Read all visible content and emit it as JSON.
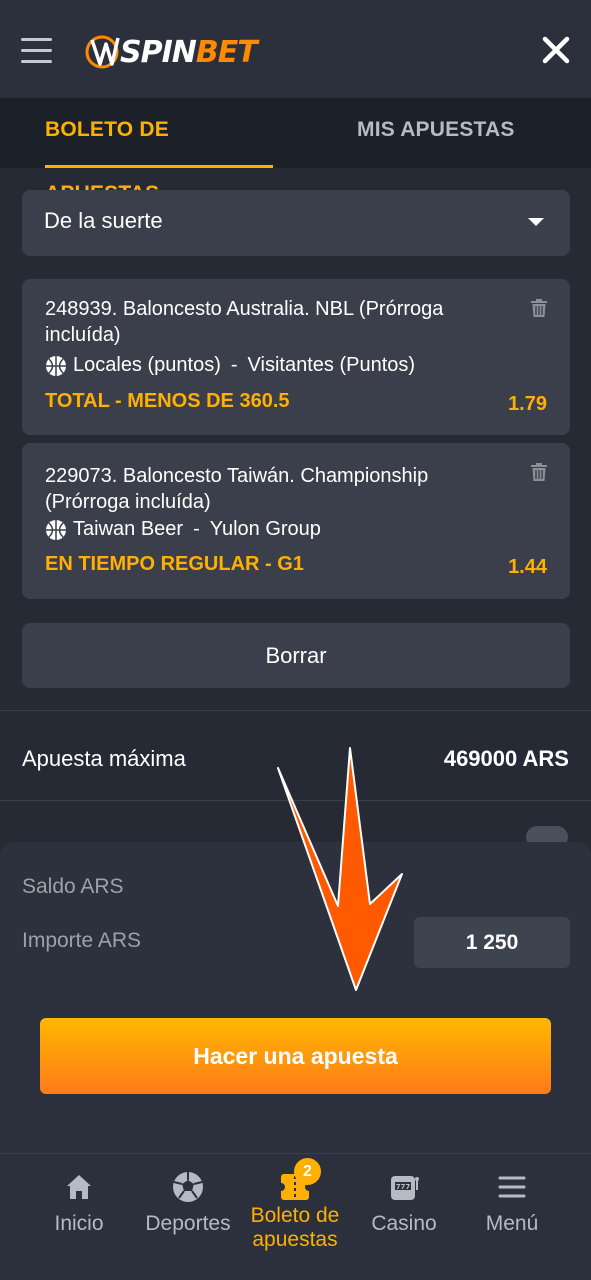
{
  "header": {
    "logo_prefix": "SPIN",
    "logo_suffix": "BET"
  },
  "tabs": [
    {
      "label": "BOLETO DE APUESTAS"
    },
    {
      "label": "MIS APUESTAS"
    }
  ],
  "bet_type": {
    "selected": "De la suerte"
  },
  "bets": [
    {
      "title": "248939. Baloncesto Australia. NBL (Prórroga incluída)",
      "home": "Locales (puntos)",
      "away": "Visitantes (Puntos)",
      "market": "TOTAL - MENOS DE 360.5",
      "odds": "1.79"
    },
    {
      "title": "229073. Baloncesto Taiwán. Championship (Prórroga incluída)",
      "home": "Taiwan Beer",
      "away": "Yulon Group",
      "market": "EN TIEMPO REGULAR - G1",
      "odds": "1.44"
    }
  ],
  "clear_label": "Borrar",
  "max_bet": {
    "label": "Apuesta máxima",
    "value": "469000 ARS"
  },
  "sheet": {
    "saldo_label": "Saldo ARS",
    "importe_label": "Importe ARS",
    "amount": "1 250",
    "place_label": "Hacer una apuesta"
  },
  "nav": {
    "items": [
      {
        "label": "Inicio",
        "icon": "home-icon"
      },
      {
        "label": "Deportes",
        "icon": "soccer-ball-icon"
      },
      {
        "label": "Boleto de apuestas",
        "icon": "bet-slip-icon",
        "badge": "2"
      },
      {
        "label": "Casino",
        "icon": "slot-machine-icon"
      },
      {
        "label": "Menú",
        "icon": "menu-icon"
      }
    ]
  },
  "colors": {
    "accent": "#ffb000",
    "arrow": "#ff5a00",
    "background": "#252a35"
  }
}
